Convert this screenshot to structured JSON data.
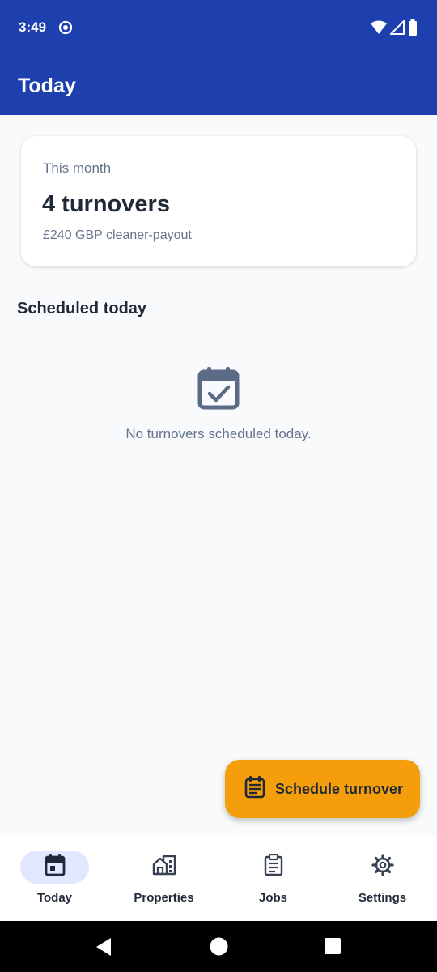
{
  "status_bar": {
    "time": "3:49",
    "icons": [
      "app-notification-icon",
      "wifi-icon",
      "cell-signal-icon",
      "battery-icon"
    ]
  },
  "app_bar": {
    "title": "Today"
  },
  "summary": {
    "label": "This month",
    "count_text": "4 turnovers",
    "payout_text": "£240 GBP cleaner-payout"
  },
  "scheduled": {
    "title": "Scheduled today",
    "empty_icon": "calendar-check-icon",
    "empty_text": "No turnovers scheduled today."
  },
  "fab": {
    "icon": "schedule-list-icon",
    "label": "Schedule turnover"
  },
  "bottom_nav": {
    "items": [
      {
        "label": "Today",
        "icon": "calendar-icon",
        "active": true
      },
      {
        "label": "Properties",
        "icon": "buildings-icon",
        "active": false
      },
      {
        "label": "Jobs",
        "icon": "clipboard-icon",
        "active": false
      },
      {
        "label": "Settings",
        "icon": "gear-icon",
        "active": false
      }
    ]
  },
  "colors": {
    "primary": "#1e40af",
    "accent": "#f59e0b",
    "background": "#f8fafc",
    "nav_active_pill": "#e0e7ff",
    "muted_text": "#64748b"
  }
}
